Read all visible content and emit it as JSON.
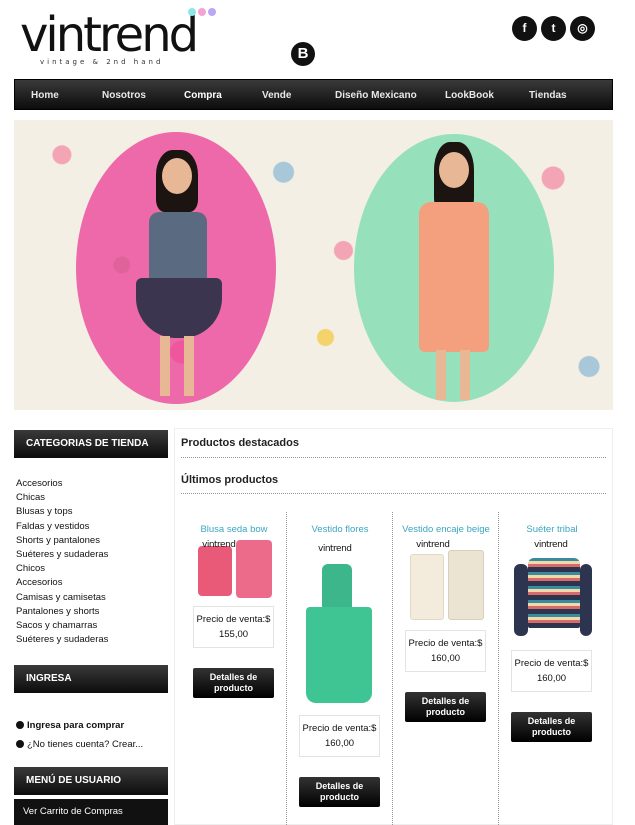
{
  "header": {
    "logo_text": "vintrend",
    "logo_tagline": "vintage & 2nd hand",
    "logo_dot_colors": [
      "#8ee6e6",
      "#f5a3d1",
      "#b9a7f5"
    ],
    "blog_icon": "blogger-icon",
    "social": [
      "facebook-icon",
      "twitter-icon",
      "instagram-icon"
    ]
  },
  "nav": {
    "items": [
      "Home",
      "Nosotros",
      "Compra",
      "Vende",
      "Diseño Mexicano",
      "LookBook",
      "Tiendas"
    ],
    "active": "Compra"
  },
  "sidebar": {
    "categories_title": "CATEGORIAS DE TIENDA",
    "categories": [
      "Accesorios",
      "Chicas",
      "Blusas y tops",
      "Faldas y vestidos",
      "Shorts y pantalones",
      "Suéteres y sudaderas",
      "Chicos",
      "Accesorios",
      "Camisas y camisetas",
      "Pantalones y shorts",
      "Sacos y chamarras",
      "Suéteres y sudaderas"
    ],
    "login_title": "INGRESA",
    "login_links": [
      "Ingresa para comprar",
      "¿No tienes cuenta? Crear..."
    ],
    "user_menu_title": "MENÚ DE USUARIO",
    "cart_link": "Ver Carrito de Compras"
  },
  "main": {
    "featured_title": "Productos destacados",
    "latest_title": "Últimos productos",
    "products": [
      {
        "name": "Blusa seda bow",
        "price_label": "Precio de venta:$",
        "price": "155,00",
        "button": "Detalles de producto"
      },
      {
        "name": "Vestido flores",
        "price_label": "Precio de venta:$",
        "price": "160,00",
        "button": "Detalles de producto"
      },
      {
        "name": "Vestido encaje beige",
        "price_label": "Precio de venta:$",
        "price": "160,00",
        "button": "Detalles de producto"
      },
      {
        "name": "Suéter tribal",
        "price_label": "Precio de venta:$",
        "price": "160,00",
        "button": "Detalles de producto"
      }
    ],
    "product_brand": "vintrend"
  }
}
